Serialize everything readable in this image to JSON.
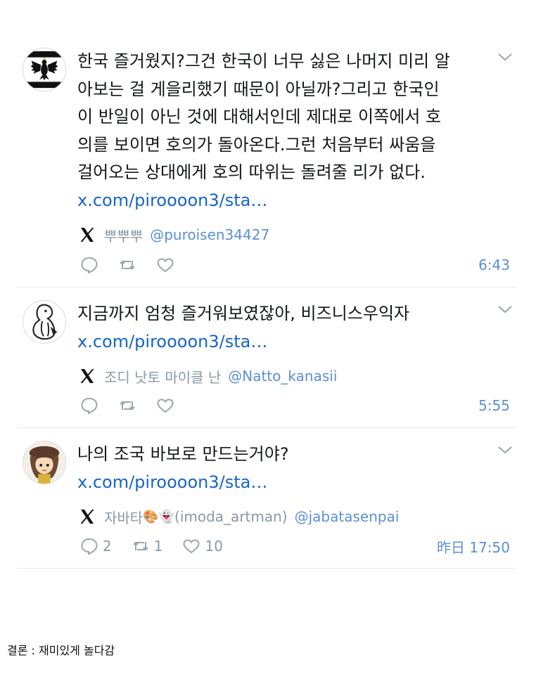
{
  "tweets": [
    {
      "text": "한국 즐거웠지?그건 한국이 너무 싫은 나머지 미리 알\n아보는 걸 게을리했기 때문이 아닐까?그리고 한국인\n이 반일이 아닌 것에 대해서인데 제대로 이쪽에서 호\n의를 보이면 호의가 돌아온다.그런 처음부터 싸움을\n걸어오는 상대에게 호의 따위는 돌려줄 리가 없다.",
      "link": "x.com/piroooon3/sta…",
      "author": "뿌뿌뿌",
      "handle": "@puroisen34427",
      "time": "6:43",
      "avatar_icon": "prussian-eagle-flag-icon"
    },
    {
      "text": "지금까지 엄청 즐거워보였잖아, 비즈니스우익자",
      "link": "x.com/piroooon3/sta…",
      "author": "조디 낫토 마이클 난",
      "handle": "@Natto_kanasii",
      "time": "5:55",
      "avatar_icon": "animal-sketch-icon"
    },
    {
      "text": "나의 조국 바보로 만드는거야?",
      "link": "x.com/piroooon3/sta…",
      "author": "자바타",
      "author_emoji": "🎨👻",
      "author_suffix": "(imoda_artman)",
      "handle": "@jabatasenpai",
      "time": "昨日 17:50",
      "replies": "2",
      "reposts": "1",
      "likes": "10",
      "avatar_icon": "anime-girl-beret-icon"
    }
  ],
  "caption": "결론 : 재미있게 놀다감",
  "colors": {
    "link": "#1565c9",
    "meta": "#8b98a5",
    "handle": "#5b8fd6"
  },
  "icons": [
    "x-logo-icon",
    "reply-icon",
    "repost-icon",
    "like-icon",
    "chevron-down-icon"
  ]
}
